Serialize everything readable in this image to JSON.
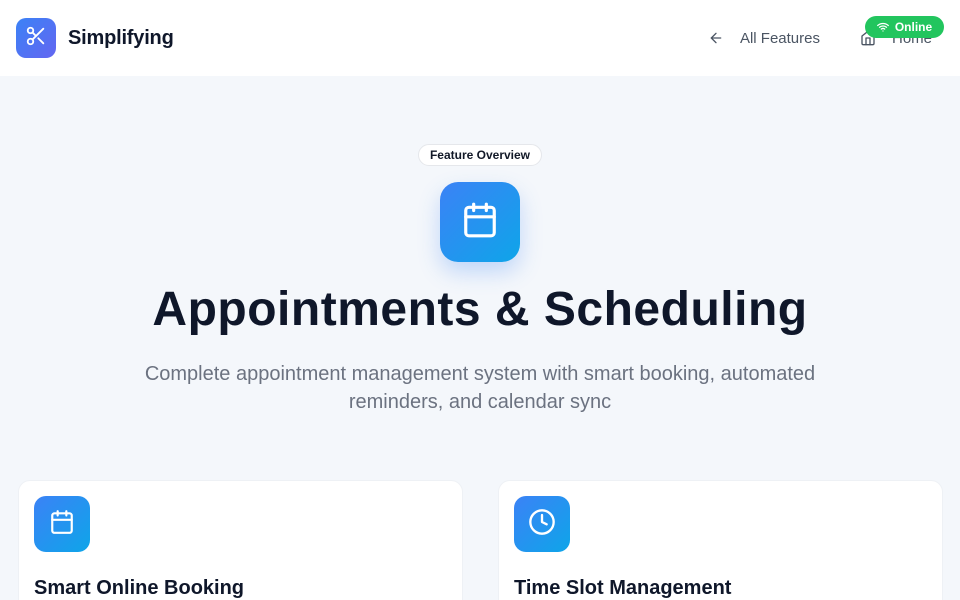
{
  "header": {
    "brand": "Simplifying",
    "logo_icon": "scissors-icon",
    "nav": {
      "all_features": "All Features",
      "home": "Home"
    },
    "status_badge": "Online"
  },
  "hero": {
    "pill": "Feature Overview",
    "icon": "calendar-icon",
    "title": "Appointments & Scheduling",
    "subtitle": "Complete appointment management system with smart booking, automated reminders, and calendar sync"
  },
  "cards": [
    {
      "icon": "calendar-icon",
      "title": "Smart Online Booking"
    },
    {
      "icon": "clock-icon",
      "title": "Time Slot Management"
    }
  ],
  "colors": {
    "accent": "#3b82f6",
    "accent_secondary": "#0ea5e9",
    "online": "#22c55e",
    "background": "#f4f7fb"
  }
}
